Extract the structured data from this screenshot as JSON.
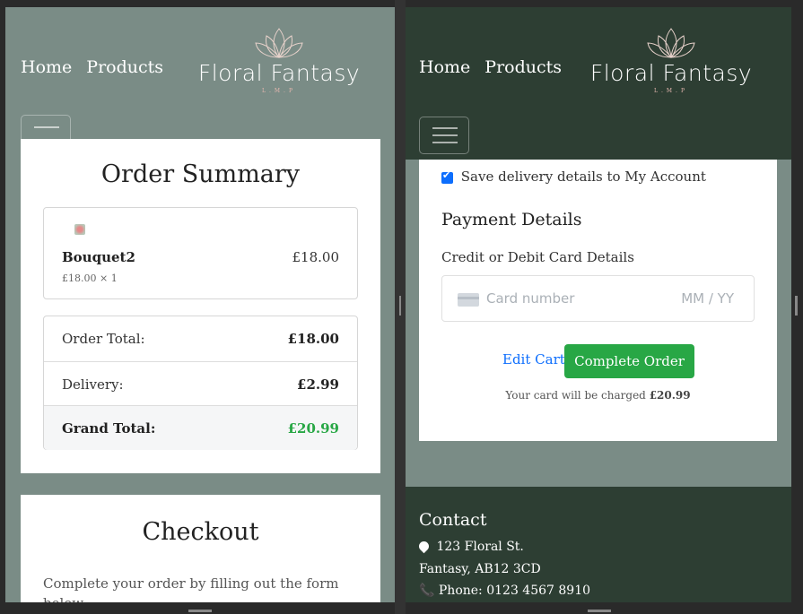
{
  "nav": {
    "links": [
      "Home",
      "Products"
    ],
    "brand": "Floral Fantasy",
    "brand_sub": "L.M.P"
  },
  "left": {
    "order_summary_title": "Order Summary",
    "item": {
      "name": "Bouquet2",
      "qty_line": "£18.00 × 1",
      "price": "£18.00"
    },
    "totals": [
      {
        "label": "Order Total:",
        "value": "£18.00"
      },
      {
        "label": "Delivery:",
        "value": "£2.99"
      },
      {
        "label": "Grand Total:",
        "value": "£20.99"
      }
    ],
    "checkout_title": "Checkout",
    "checkout_text": "Complete your order by filling out the form",
    "checkout_text_cut": "below."
  },
  "right": {
    "save_details_label": "Save delivery details to My Account",
    "payment_heading": "Payment Details",
    "card_label": "Credit or Debit Card Details",
    "card_placeholder": "Card number",
    "expiry_placeholder": "MM / YY",
    "edit_cart": "Edit Cart",
    "complete_order": "Complete Order",
    "charge_text": "Your card will be charged",
    "charge_amount": "£20.99",
    "contact_heading": "Contact",
    "address_line1": "123 Floral St.",
    "address_line2": "Fantasy, AB12 3CD",
    "phone": "Phone: 0123 4567 8910"
  },
  "colors": {
    "nav_dark": "#2d3e33",
    "page_sage": "#7a8c86",
    "grand_total_green": "#28a745",
    "link_blue": "#0d6efd"
  }
}
